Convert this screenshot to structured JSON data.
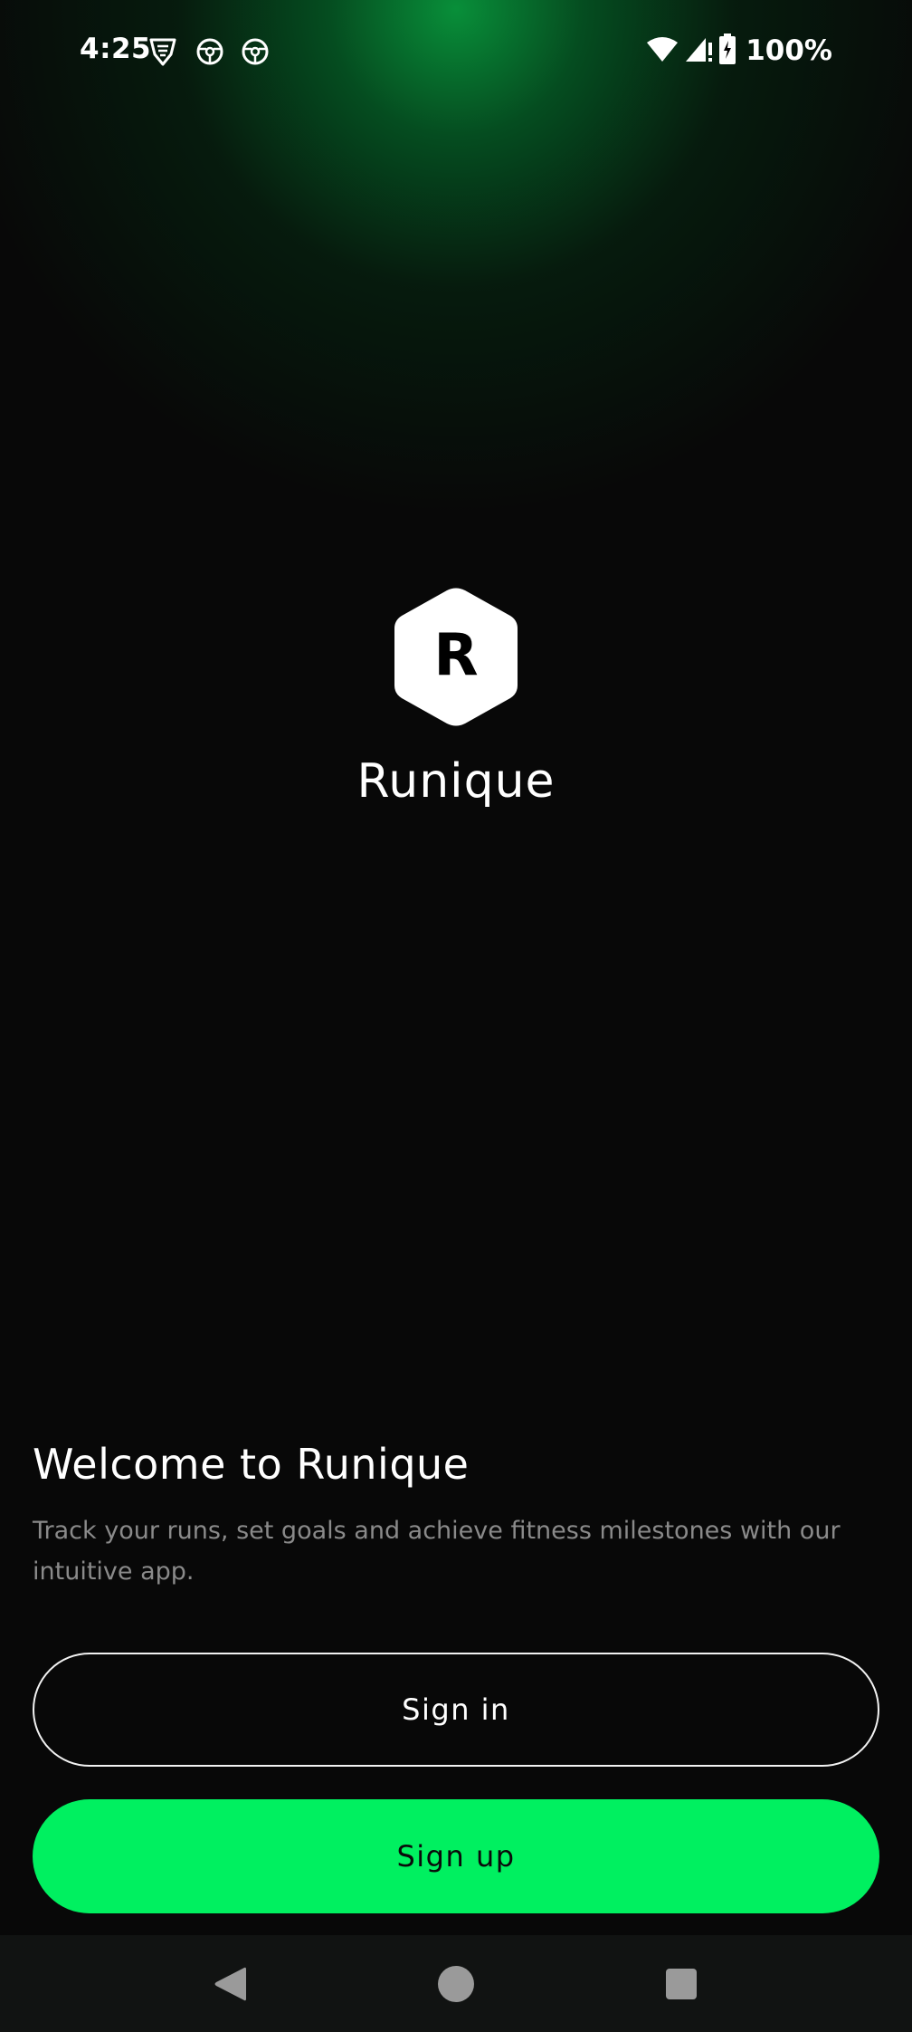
{
  "status_bar": {
    "time": "4:25",
    "battery": "100%",
    "icons": [
      "vpn-shield-icon",
      "steering-wheel-icon",
      "steering-wheel-icon",
      "wifi-icon",
      "signal-icon",
      "battery-charging-icon"
    ]
  },
  "app": {
    "logo_letter": "R",
    "name": "Runique"
  },
  "welcome": {
    "title": "Welcome to Runique",
    "description": "Track your runs, set goals and achieve fitness milestones with our intuitive app."
  },
  "buttons": {
    "sign_in": "Sign in",
    "sign_up": "Sign up"
  },
  "nav": {
    "items": [
      "back-icon",
      "home-icon",
      "recents-icon"
    ]
  },
  "colors": {
    "background": "#080808",
    "accent": "#00f060",
    "glow": "#08963c",
    "muted_text": "#8a8a8a",
    "nav_bar": "#111312"
  }
}
